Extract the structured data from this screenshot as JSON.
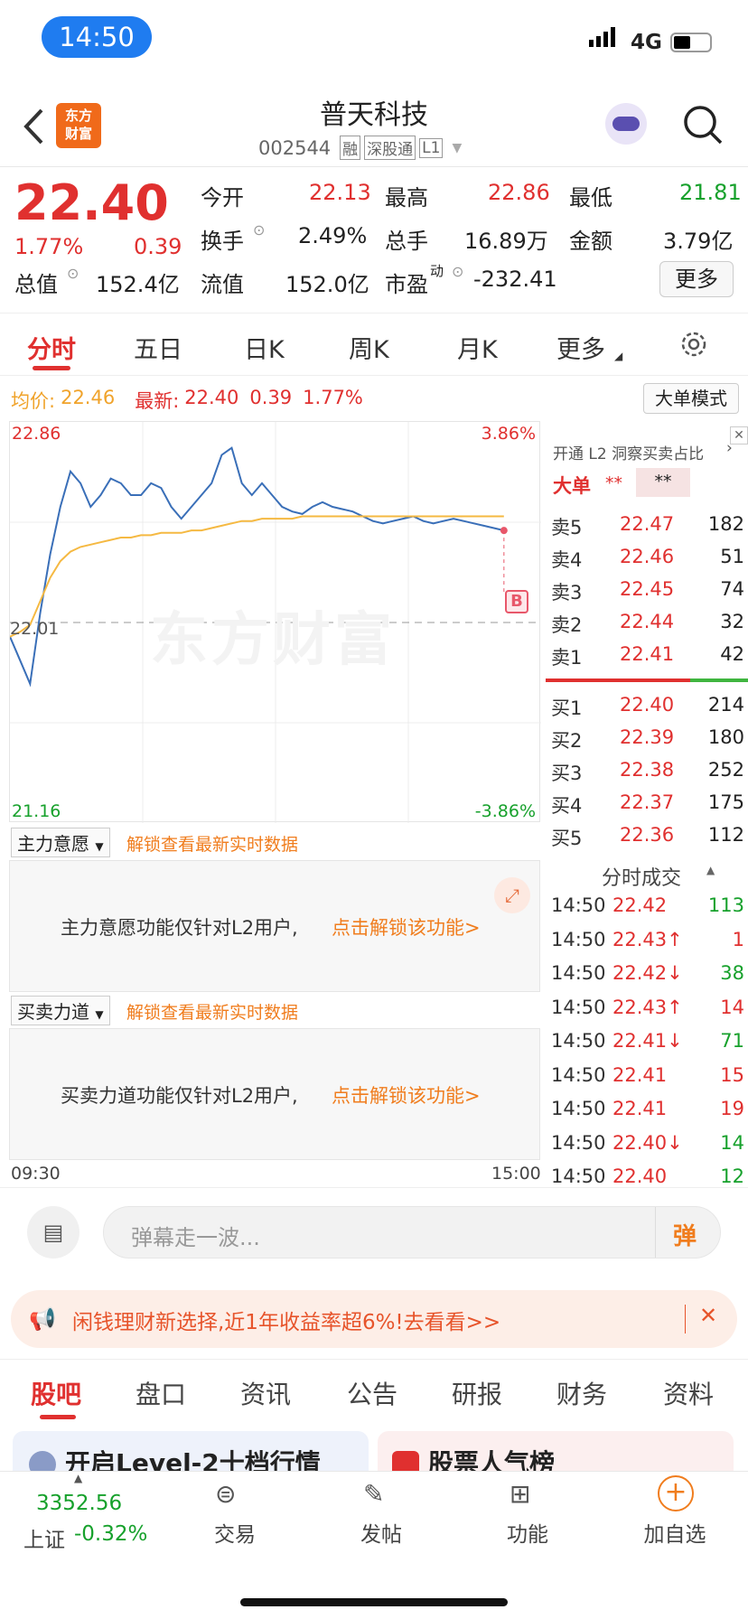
{
  "status": {
    "time": "14:50",
    "network": "4G"
  },
  "header": {
    "title": "普天科技",
    "code": "002544",
    "tag1": "融",
    "tag2": "深股通",
    "tag3": "L1",
    "logo_text1": "东方",
    "logo_text2": "财富"
  },
  "quote": {
    "price": "22.40",
    "pct": "1.77%",
    "chg": "0.39",
    "open_label": "今开",
    "open": "22.13",
    "high_label": "最高",
    "high": "22.86",
    "low_label": "最低",
    "low": "21.81",
    "turnover_label": "换手",
    "turnover": "2.49%",
    "vol_label": "总手",
    "vol": "16.89万",
    "amount_label": "金额",
    "amount": "3.79亿",
    "mcap_label": "总值",
    "mcap": "152.4亿",
    "float_label": "流值",
    "float": "152.0亿",
    "pe_label": "市盈",
    "pe_sup": "动",
    "pe": "-232.41",
    "more": "更多"
  },
  "tabs": [
    "分时",
    "五日",
    "日K",
    "周K",
    "月K",
    "更多"
  ],
  "chart_info": {
    "avg_label": "均价:",
    "avg": "22.46",
    "last_label": "最新:",
    "last": "22.40",
    "chg": "0.39",
    "pct": "1.77%",
    "mode_btn": "大单模式"
  },
  "chart_data": {
    "type": "line",
    "title": "",
    "xlabel": "",
    "ylabel": "",
    "ylim": [
      21.16,
      22.86
    ],
    "y_labels": [
      "22.86",
      "21.16"
    ],
    "y_right": [
      "3.86%",
      "-3.86%"
    ],
    "baseline": "22.01",
    "x_labels": [
      "09:30",
      "15:00"
    ],
    "series": [
      {
        "name": "价格",
        "color": "#3a6fb8",
        "values": [
          21.95,
          21.85,
          21.75,
          22.05,
          22.3,
          22.5,
          22.65,
          22.6,
          22.5,
          22.55,
          22.62,
          22.6,
          22.55,
          22.55,
          22.6,
          22.58,
          22.5,
          22.45,
          22.5,
          22.55,
          22.6,
          22.72,
          22.75,
          22.6,
          22.55,
          22.6,
          22.55,
          22.5,
          22.48,
          22.47,
          22.5,
          22.52,
          22.5,
          22.49,
          22.48,
          22.46,
          22.44,
          22.43,
          22.44,
          22.45,
          22.46,
          22.44,
          22.43,
          22.44,
          22.45,
          22.44,
          22.43,
          22.42,
          22.41,
          22.4
        ]
      },
      {
        "name": "均价",
        "color": "#f5b942",
        "values": [
          21.95,
          21.97,
          22.0,
          22.1,
          22.2,
          22.27,
          22.31,
          22.33,
          22.34,
          22.35,
          22.36,
          22.37,
          22.37,
          22.38,
          22.38,
          22.39,
          22.39,
          22.39,
          22.4,
          22.4,
          22.41,
          22.42,
          22.43,
          22.44,
          22.44,
          22.45,
          22.45,
          22.45,
          22.45,
          22.46,
          22.46,
          22.46,
          22.46,
          22.46,
          22.46,
          22.46,
          22.46,
          22.46,
          22.46,
          22.46,
          22.46,
          22.46,
          22.46,
          22.46,
          22.46,
          22.46,
          22.46,
          22.46,
          22.46,
          22.46
        ]
      }
    ]
  },
  "book": {
    "promo": "开通 L2 洞察买卖占比",
    "big_label": "大单",
    "stars": "**",
    "sells": [
      {
        "l": "卖5",
        "p": "22.47",
        "v": "182"
      },
      {
        "l": "卖4",
        "p": "22.46",
        "v": "51"
      },
      {
        "l": "卖3",
        "p": "22.45",
        "v": "74"
      },
      {
        "l": "卖2",
        "p": "22.44",
        "v": "32"
      },
      {
        "l": "卖1",
        "p": "22.41",
        "v": "42"
      }
    ],
    "buys": [
      {
        "l": "买1",
        "p": "22.40",
        "v": "214"
      },
      {
        "l": "买2",
        "p": "22.39",
        "v": "180"
      },
      {
        "l": "买3",
        "p": "22.38",
        "v": "252"
      },
      {
        "l": "买4",
        "p": "22.37",
        "v": "175"
      },
      {
        "l": "买5",
        "p": "22.36",
        "v": "112"
      }
    ],
    "ticks_title": "分时成交",
    "ticks": [
      {
        "t": "14:50",
        "p": "22.42",
        "v": "113",
        "c": "green"
      },
      {
        "t": "14:50",
        "p": "22.43↑",
        "v": "1",
        "c": "red"
      },
      {
        "t": "14:50",
        "p": "22.42↓",
        "v": "38",
        "c": "green"
      },
      {
        "t": "14:50",
        "p": "22.43↑",
        "v": "14",
        "c": "red"
      },
      {
        "t": "14:50",
        "p": "22.41↓",
        "v": "71",
        "c": "green"
      },
      {
        "t": "14:50",
        "p": "22.41",
        "v": "15",
        "c": "red"
      },
      {
        "t": "14:50",
        "p": "22.41",
        "v": "19",
        "c": "red"
      },
      {
        "t": "14:50",
        "p": "22.40↓",
        "v": "14",
        "c": "green"
      },
      {
        "t": "14:50",
        "p": "22.40",
        "v": "12",
        "c": "green"
      }
    ]
  },
  "panels": {
    "p1_label": "主力意愿",
    "p1_link": "解锁查看最新实时数据",
    "p1_msg": "主力意愿功能仅针对L2用户,",
    "p1_cta": "点击解锁该功能>",
    "p2_label": "买卖力道",
    "p2_link": "解锁查看最新实时数据",
    "p2_msg": "买卖力道功能仅针对L2用户,",
    "p2_cta": "点击解锁该功能>"
  },
  "danmu": {
    "placeholder": "弹幕走一波...",
    "btn": "弹"
  },
  "ad": {
    "text": "闲钱理财新选择,近1年收益率超6%!去看看>>"
  },
  "ftabs": [
    "股吧",
    "盘口",
    "资讯",
    "公告",
    "研报",
    "财务",
    "资料"
  ],
  "cards": {
    "left": "开启Level-2十档行情",
    "right": "股票人气榜"
  },
  "bottom": {
    "index_val": "3352.56",
    "index_name": "上证",
    "index_pct": "-0.32%",
    "trade": "交易",
    "post": "发帖",
    "func": "功能",
    "add": "加自选"
  }
}
